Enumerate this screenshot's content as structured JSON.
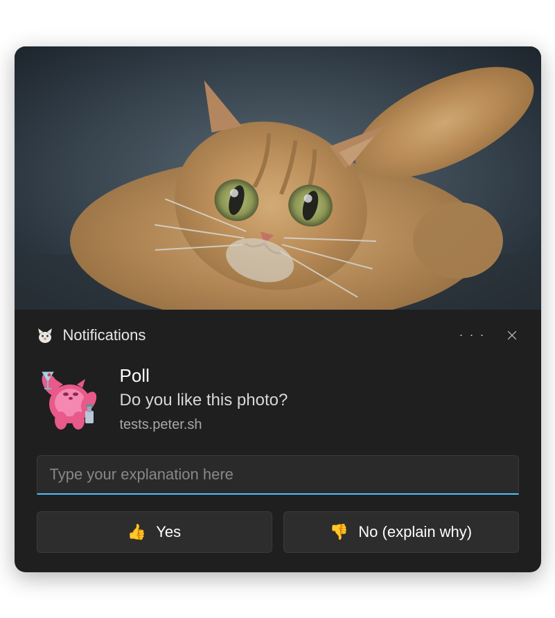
{
  "header": {
    "app_name": "Notifications"
  },
  "body": {
    "title": "Poll",
    "message": "Do you like this photo?",
    "source": "tests.peter.sh"
  },
  "input": {
    "placeholder": "Type your explanation here",
    "value": ""
  },
  "actions": {
    "yes": {
      "emoji": "👍",
      "label": "Yes"
    },
    "no": {
      "emoji": "👎",
      "label": "No (explain why)"
    }
  }
}
